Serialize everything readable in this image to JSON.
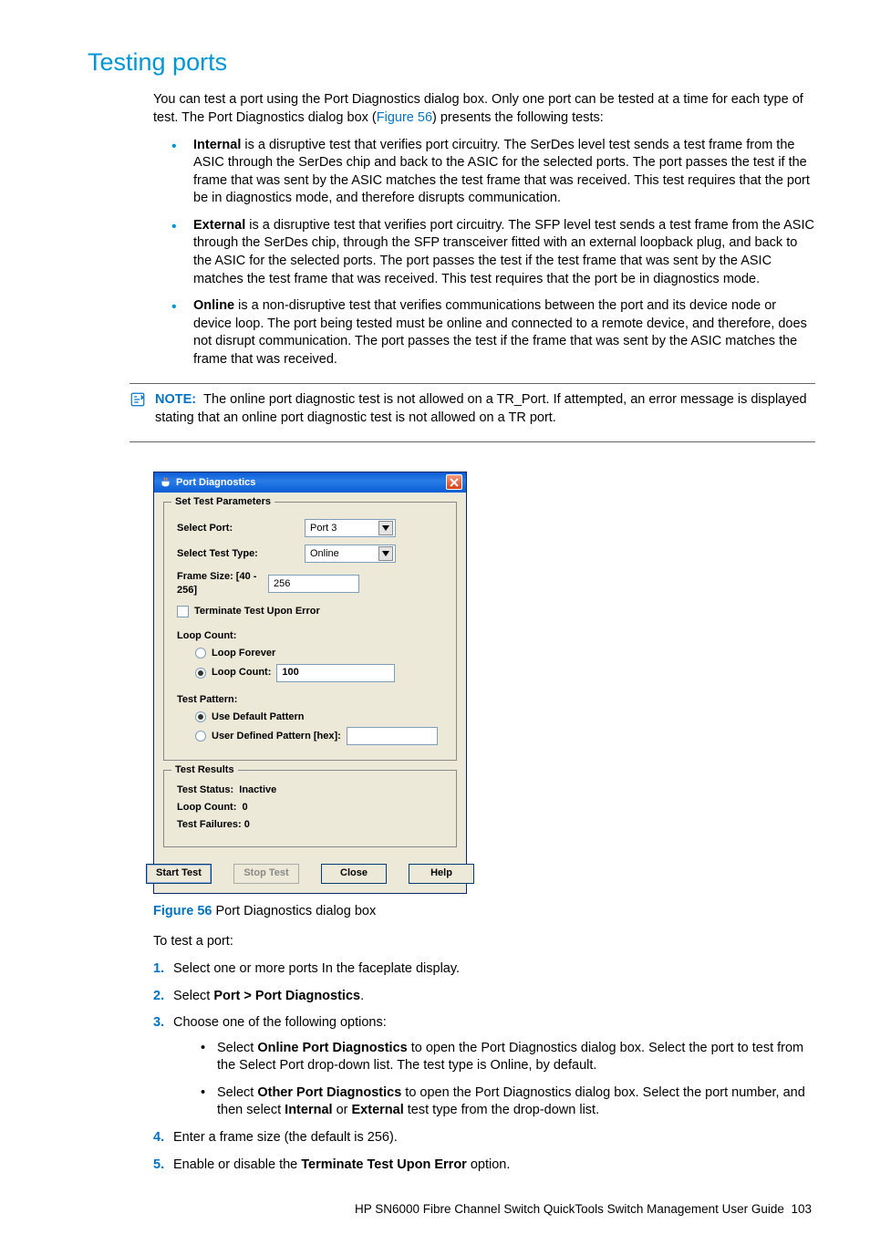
{
  "heading": "Testing ports",
  "intro": {
    "part1": "You can test a port using the Port Diagnostics dialog box. Only one port can be tested at a time for each type of test. The Port Diagnostics dialog box (",
    "link": "Figure 56",
    "part2": ") presents the following tests:"
  },
  "tests": {
    "internal": {
      "label": "Internal",
      "text": " is a disruptive test that verifies port circuitry. The SerDes level test sends a test frame from the ASIC through the SerDes chip and back to the ASIC for the selected ports. The port passes the test if the frame that was sent by the ASIC matches the test frame that was received. This test requires that the port be in diagnostics mode, and therefore disrupts communication."
    },
    "external": {
      "label": "External",
      "text": " is a disruptive test that verifies port circuitry. The SFP level test sends a test frame from the ASIC through the SerDes chip, through the SFP transceiver fitted with an external loopback plug, and back to the ASIC for the selected ports. The port passes the test if the test frame that was sent by the ASIC matches the test frame that was received. This test requires that the port be in diagnostics mode."
    },
    "online": {
      "label": "Online",
      "text": " is a non-disruptive test that verifies communications between the port and its device node or device loop. The port being tested must be online and connected to a remote device, and therefore, does not disrupt communication. The port passes the test if the frame that was sent by the ASIC matches the frame that was received."
    }
  },
  "note": {
    "label": "NOTE:",
    "text": "The online port diagnostic test is not allowed on a TR_Port. If attempted, an error message is displayed stating that an online port diagnostic test is not allowed on a TR port."
  },
  "dialog": {
    "title": "Port Diagnostics",
    "groups": {
      "params_legend": "Set Test Parameters",
      "results_legend": "Test Results"
    },
    "labels": {
      "select_port": "Select Port:",
      "select_test_type": "Select Test Type:",
      "frame_size": "Frame Size: [40 - 256]",
      "terminate": "Terminate Test Upon Error",
      "loop_count_header": "Loop Count:",
      "loop_forever": "Loop Forever",
      "loop_count_radio": "Loop Count:",
      "test_pattern_header": "Test Pattern:",
      "use_default": "Use Default Pattern",
      "user_defined": "User Defined Pattern [hex]:"
    },
    "values": {
      "port": "Port 3",
      "test_type": "Online",
      "frame_size": "256",
      "loop_count": "100",
      "user_pattern": ""
    },
    "results": {
      "status_label": "Test Status:",
      "status_value": "Inactive",
      "loop_label": "Loop Count:",
      "loop_value": "0",
      "failures_label": "Test Failures:",
      "failures_value": "0"
    },
    "buttons": {
      "start": "Start Test",
      "stop": "Stop Test",
      "close": "Close",
      "help": "Help"
    }
  },
  "figure": {
    "label": "Figure 56",
    "caption": " Port Diagnostics dialog box"
  },
  "post_text": "To test a port:",
  "steps": {
    "s1": "Select one or more ports In the faceplate display.",
    "s2": {
      "pre": "Select ",
      "bold": "Port > Port Diagnostics",
      "post": "."
    },
    "s3": "Choose one of the following options:",
    "s3a": {
      "pre": "Select ",
      "b1": "Online Port Diagnostics",
      "post": " to open the Port Diagnostics dialog box. Select the port to test from the Select Port drop-down list. The test type is Online, by default."
    },
    "s3b": {
      "pre": "Select ",
      "b1": "Other Port Diagnostics",
      "mid": " to open the Port Diagnostics dialog box. Select the port number, and then select ",
      "b2": "Internal",
      "or": " or ",
      "b3": "External",
      "post": " test type from the drop-down list."
    },
    "s4": "Enter a frame size (the default is 256).",
    "s5": {
      "pre": "Enable or disable the ",
      "bold": "Terminate Test Upon Error",
      "post": " option."
    }
  },
  "footer": {
    "doc": "HP SN6000 Fibre Channel Switch QuickTools Switch Management User Guide",
    "page": "103"
  }
}
